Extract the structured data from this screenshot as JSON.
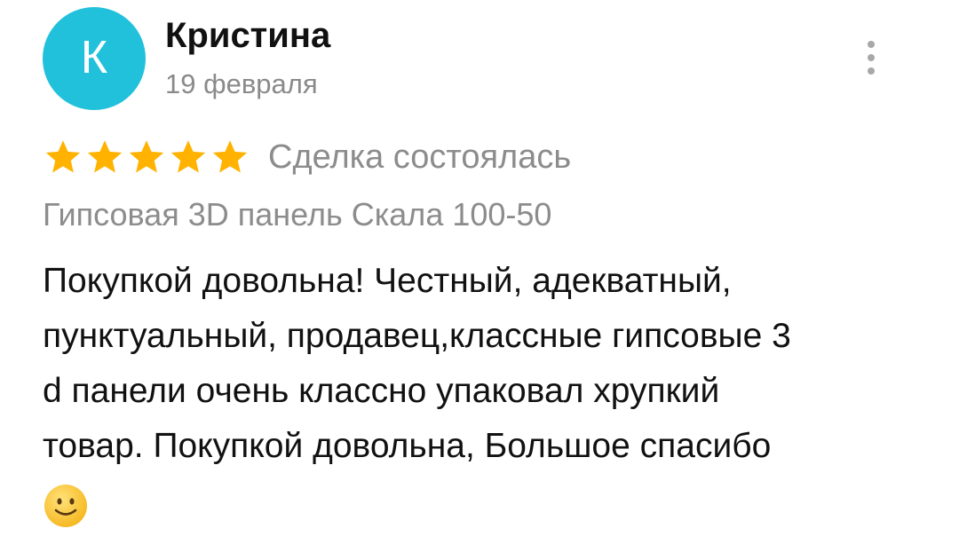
{
  "review": {
    "author": {
      "initial": "К",
      "name": "Кристина",
      "avatar_color": "#21c1dc"
    },
    "date": "19 февраля",
    "menu_icon": "more-vertical-icon",
    "rating": {
      "stars": 5,
      "max": 5,
      "star_color": "#ffb300"
    },
    "deal_status": "Сделка состоялась",
    "product": "Гипсовая 3D панель Скала 100-50",
    "text_lines": [
      "Покупкой довольна! Честный, адекватный,",
      "пунктуальный, продавец,классные гипсовые 3",
      "d панели очень классно упаковал хрупкий",
      "товар. Покупкой довольна, Большое спасибо"
    ],
    "emoji": "slightly-smiling-face-icon"
  }
}
